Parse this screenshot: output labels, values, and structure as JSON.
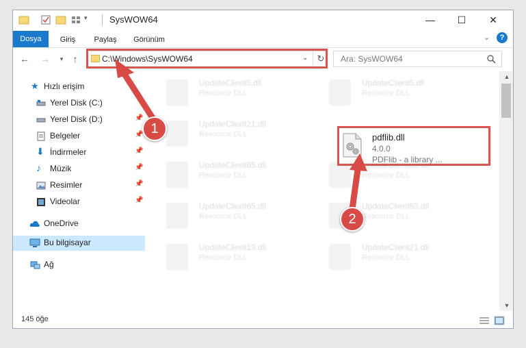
{
  "window": {
    "title": "SysWOW64",
    "controls": {
      "minimize": "—",
      "maximize": "☐",
      "close": "✕"
    }
  },
  "ribbon": {
    "tabs": [
      "Dosya",
      "Giriş",
      "Paylaş",
      "Görünüm"
    ],
    "expand_icon": "chevron-down-icon",
    "help": "?"
  },
  "address": {
    "path": "C:\\Windows\\SysWOW64",
    "search_placeholder": "Ara: SysWOW64"
  },
  "sidebar": {
    "items": [
      {
        "label": "Hızlı erişim",
        "icon": "star-icon"
      },
      {
        "label": "Yerel Disk (C:)",
        "icon": "drive-icon"
      },
      {
        "label": "Yerel Disk (D:)",
        "icon": "drive-icon"
      },
      {
        "label": "Belgeler",
        "icon": "documents-icon"
      },
      {
        "label": "İndirmeler",
        "icon": "download-icon"
      },
      {
        "label": "Müzik",
        "icon": "music-icon"
      },
      {
        "label": "Resimler",
        "icon": "pictures-icon"
      },
      {
        "label": "Videolar",
        "icon": "video-icon"
      },
      {
        "label": "OneDrive",
        "icon": "cloud-icon"
      },
      {
        "label": "Bu bilgisayar",
        "icon": "computer-icon"
      },
      {
        "label": "Ağ",
        "icon": "network-icon"
      }
    ]
  },
  "files": {
    "ghost_items": [
      {
        "name": "UpdateClient5.dll",
        "type": "Resource DLL"
      },
      {
        "name": "UpdateClient5.dll",
        "type": "Resource DLL"
      },
      {
        "name": "UpdateClient21.dll",
        "type": "Resource DLL"
      },
      {
        "name": "UpdateClient65.dll",
        "type": "Resource DLL"
      },
      {
        "name": "UpdateClient63.dll",
        "type": "Resource DLL"
      },
      {
        "name": "UpdateClient65.dll",
        "type": "Resource DLL"
      },
      {
        "name": "UpdateClient63.dll",
        "type": "Resource DLL"
      },
      {
        "name": "UpdateClient19.dll",
        "type": "Resource DLL"
      },
      {
        "name": "UpdateClient21.dll",
        "type": "Resource DLL"
      }
    ],
    "target": {
      "name": "pdflib.dll",
      "version": "4.0.0",
      "description": "PDFlib - a library ..."
    }
  },
  "status": {
    "count": "145 öğe"
  },
  "callouts": [
    "1",
    "2"
  ],
  "colors": {
    "accent": "#1979ca",
    "highlight": "#d9534f",
    "selected": "#cce8ff"
  }
}
